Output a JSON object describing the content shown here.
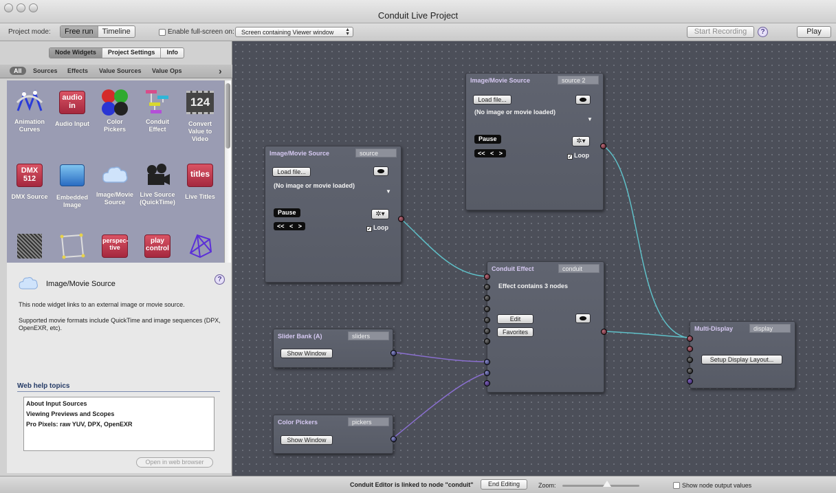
{
  "window": {
    "title": "Conduit Live Project"
  },
  "toolbar": {
    "project_mode_label": "Project mode:",
    "modes": [
      "Free run",
      "Timeline"
    ],
    "selected_mode": "Free run",
    "fullscreen_label": "Enable full-screen on:",
    "fullscreen_checked": false,
    "screen_select_value": "Screen containing Viewer window",
    "start_recording_label": "Start Recording",
    "help_glyph": "?",
    "play_label": "Play"
  },
  "left_panel": {
    "tabs": [
      "Node Widgets",
      "Project Settings",
      "Info"
    ],
    "selected_tab": "Node Widgets",
    "filters": [
      "All",
      "Sources",
      "Effects",
      "Value Sources",
      "Value Ops"
    ],
    "selected_filter": "All",
    "more_glyph": "›",
    "widgets": [
      {
        "label": "Animation\nCurves",
        "icon": "animation-curves-icon"
      },
      {
        "label": "Audio Input",
        "icon": "audio-in-icon",
        "tile_text": "audio in"
      },
      {
        "label": "Color\nPickers",
        "icon": "color-pickers-icon"
      },
      {
        "label": "Conduit\nEffect",
        "icon": "conduit-effect-icon"
      },
      {
        "label": "Convert\nValue to\nVideo",
        "icon": "convert-value-icon",
        "tile_text": "124"
      },
      {
        "label": "DMX Source",
        "icon": "dmx-icon",
        "tile_text": "DMX 512"
      },
      {
        "label": "Embedded\nImage",
        "icon": "embedded-image-icon"
      },
      {
        "label": "Image/Movie\nSource",
        "icon": "cloud-icon"
      },
      {
        "label": "Live Source\n(QuickTime)",
        "icon": "camera-icon"
      },
      {
        "label": "Live Titles",
        "icon": "titles-icon",
        "tile_text": "titles"
      },
      {
        "label": "",
        "icon": "noise-icon"
      },
      {
        "label": "",
        "icon": "shape-icon"
      },
      {
        "label": "",
        "icon": "perspective-icon",
        "tile_text": "perspec-tive"
      },
      {
        "label": "",
        "icon": "play-control-icon",
        "tile_text": "play control"
      },
      {
        "label": "",
        "icon": "mesh-icon"
      }
    ],
    "info": {
      "title": "Image/Movie Source",
      "description": "This node widget links to an external image or movie source.",
      "formats": "Supported movie formats include QuickTime and image sequences (DPX, OpenEXR, etc).",
      "web_help_heading": "Web help topics",
      "web_topics": [
        "About Input Sources",
        "Viewing Previews and Scopes",
        "Pro Pixels: raw YUV, DPX, OpenEXR"
      ],
      "open_browser_label": "Open in web browser"
    }
  },
  "nodes": {
    "source": {
      "title": "Image/Movie Source",
      "name": "source",
      "load_label": "Load file...",
      "status": "(No image or movie loaded)",
      "pause_label": "Pause",
      "transport": "<< < >",
      "loop_label": "Loop",
      "loop_checked": true
    },
    "source2": {
      "title": "Image/Movie Source",
      "name": "source 2",
      "load_label": "Load file...",
      "status": "(No image or movie loaded)",
      "pause_label": "Pause",
      "transport": "<< < >",
      "loop_label": "Loop",
      "loop_checked": true
    },
    "conduit": {
      "title": "Conduit Effect",
      "name": "conduit",
      "summary": "Effect contains 3 nodes",
      "edit_label": "Edit",
      "favorites_label": "Favorites"
    },
    "sliders": {
      "title": "Slider Bank (A)",
      "name": "sliders",
      "show_label": "Show Window"
    },
    "pickers": {
      "title": "Color Pickers",
      "name": "pickers",
      "show_label": "Show Window"
    },
    "display": {
      "title": "Multi-Display",
      "name": "display",
      "setup_label": "Setup Display Layout..."
    }
  },
  "wire_colors": {
    "video": "#5fc1c9",
    "value": "#8a6fd0"
  },
  "status_bar": {
    "linked_text": "Conduit Editor is linked to node \"conduit\"",
    "end_editing_label": "End Editing",
    "zoom_label": "Zoom:",
    "zoom_level": 0.55,
    "show_values_label": "Show node output values",
    "show_values_checked": false
  }
}
